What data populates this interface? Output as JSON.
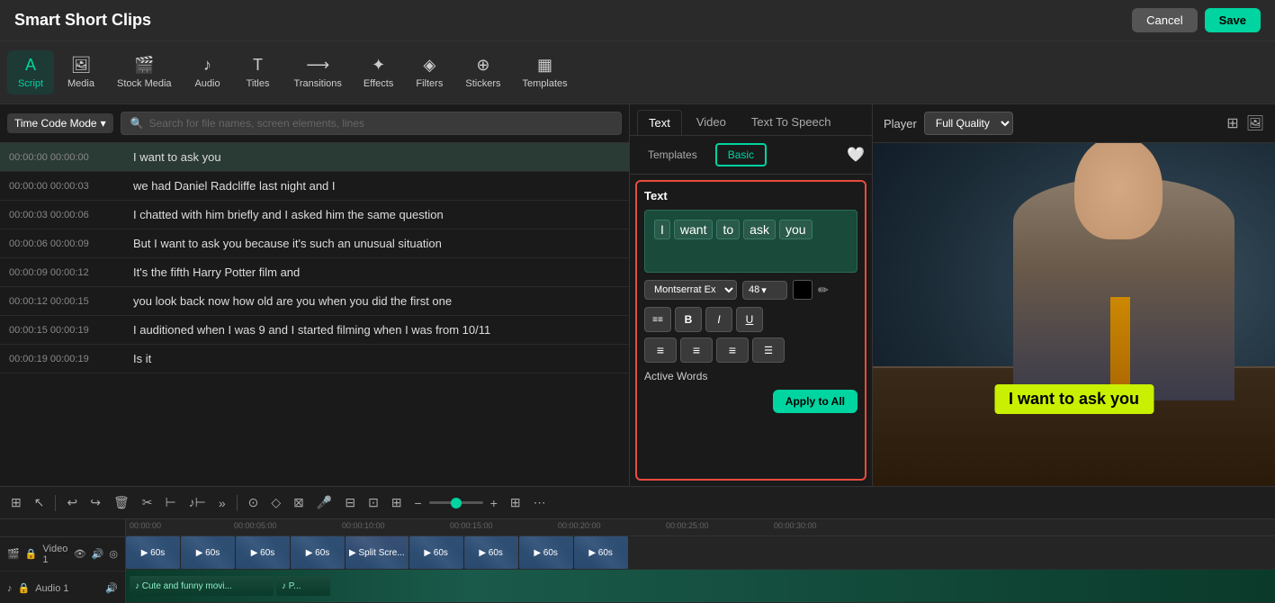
{
  "app": {
    "title": "Smart Short Clips",
    "cancel_label": "Cancel",
    "save_label": "Save"
  },
  "toolbar": {
    "items": [
      {
        "id": "script",
        "label": "Script",
        "icon": "A",
        "active": true
      },
      {
        "id": "media",
        "label": "Media",
        "icon": "🖼"
      },
      {
        "id": "stock",
        "label": "Stock Media",
        "icon": "🎬"
      },
      {
        "id": "audio",
        "label": "Audio",
        "icon": "🎵"
      },
      {
        "id": "titles",
        "label": "Titles",
        "icon": "T"
      },
      {
        "id": "transitions",
        "label": "Transitions",
        "icon": "⟶"
      },
      {
        "id": "effects",
        "label": "Effects",
        "icon": "✦"
      },
      {
        "id": "filters",
        "label": "Filters",
        "icon": "◈"
      },
      {
        "id": "stickers",
        "label": "Stickers",
        "icon": "⊕"
      },
      {
        "id": "templates",
        "label": "Templates",
        "icon": "▦"
      }
    ]
  },
  "script": {
    "time_mode": "Time Code Mode",
    "search_placeholder": "Search for file names, screen elements, lines",
    "rows": [
      {
        "time_start": "00:00:00",
        "time_end": "00:00:00",
        "text": "I want to ask you",
        "active": true
      },
      {
        "time_start": "00:00:00",
        "time_end": "00:00:03",
        "text": "we had Daniel Radcliffe last night and I"
      },
      {
        "time_start": "00:00:03",
        "time_end": "00:00:06",
        "text": "I chatted with him briefly and I asked him the same question"
      },
      {
        "time_start": "00:00:06",
        "time_end": "00:00:09",
        "text": "But I want to ask you because it's such an unusual situation"
      },
      {
        "time_start": "00:00:09",
        "time_end": "00:00:12",
        "text": "It's the fifth Harry Potter film and"
      },
      {
        "time_start": "00:00:12",
        "time_end": "00:00:15",
        "text": "you look back now how old are you when you did the first one"
      },
      {
        "time_start": "00:00:15",
        "time_end": "00:00:19",
        "text": "I auditioned when I was 9 and I started filming when I was from 10/11"
      },
      {
        "time_start": "00:00:19",
        "time_end": "00:00:19",
        "text": "Is it"
      }
    ]
  },
  "right_panel": {
    "tabs": [
      {
        "label": "Text",
        "active": true
      },
      {
        "label": "Video"
      },
      {
        "label": "Text To Speech"
      }
    ],
    "subtabs": [
      {
        "label": "Templates"
      },
      {
        "label": "Basic",
        "active": true
      }
    ],
    "text_section": {
      "label": "Text",
      "words": [
        "I",
        "want",
        "to",
        "ask",
        "you"
      ],
      "font": "Montserrat Ex",
      "font_size": "48",
      "font_size_arrow": "▾",
      "color": "#000000",
      "format_buttons": [
        "B",
        "I",
        "U"
      ],
      "align_buttons": [
        "≡",
        "≡",
        "≡",
        "≡"
      ],
      "active_words_label": "Active Words",
      "apply_all_label": "Apply to All"
    }
  },
  "preview": {
    "label": "Player",
    "quality": "Full Quality",
    "subtitle": "I want to ask you"
  },
  "timeline": {
    "time_marks": [
      "00:00:00",
      "00:00:05:00",
      "00:00:10:00",
      "00:00:15:00",
      "00:00:20:00",
      "00:00:25:00",
      "00:00:30:00"
    ],
    "tracks": [
      {
        "label": "Video 1",
        "type": "video",
        "clips": [
          {
            "label": "60s"
          },
          {
            "label": "60s"
          },
          {
            "label": "60s"
          },
          {
            "label": "60s"
          },
          {
            "label": "Split Scre..."
          },
          {
            "label": "60s"
          },
          {
            "label": "60s"
          },
          {
            "label": "60s"
          },
          {
            "label": "60s"
          }
        ]
      },
      {
        "label": "Audio 1",
        "type": "audio",
        "clips": [
          {
            "label": "Cute and funny movi..."
          },
          {
            "label": "P..."
          }
        ]
      }
    ]
  }
}
